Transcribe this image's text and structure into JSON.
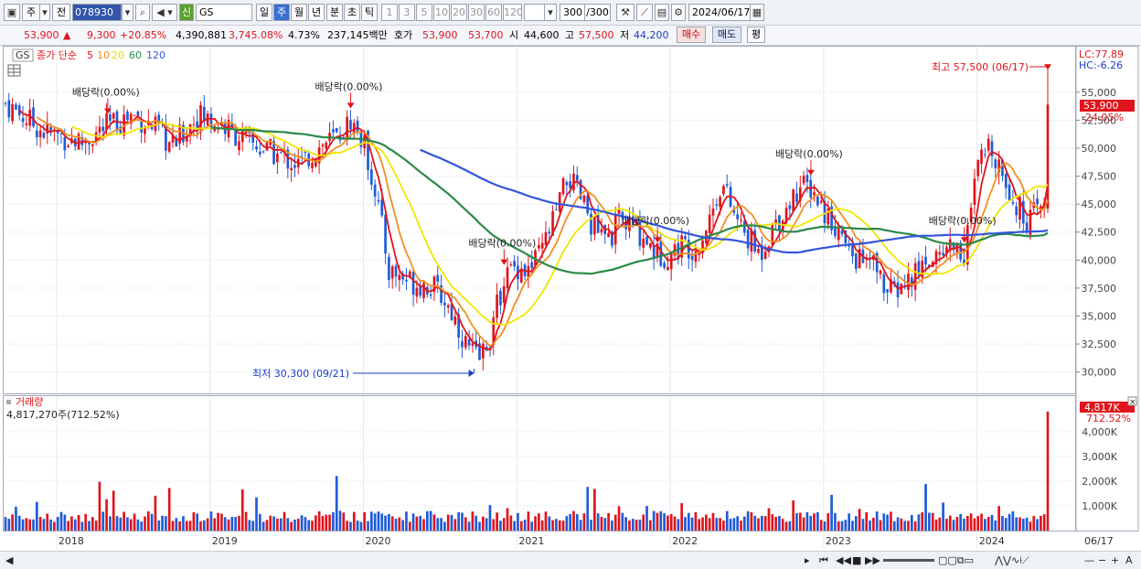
{
  "toolbar": {
    "buttons_left": [
      "주",
      "전"
    ],
    "code": "078930",
    "market_badge": "신",
    "name": "GS",
    "periods": [
      "일",
      "주",
      "월",
      "년",
      "분",
      "초",
      "틱"
    ],
    "selected_period": "주",
    "intervals": [
      "1",
      "3",
      "5",
      "10",
      "20",
      "30",
      "60",
      "120"
    ],
    "count": "300",
    "count_total": "/300",
    "date": "2024/06/17"
  },
  "infobar": {
    "price": "53,900",
    "change_arrow": "▲",
    "change": "9,300",
    "change_pct": "+20.85%",
    "volume": "4,390,881",
    "volume_ratio": "3,745.08%",
    "turnover": "4.73%",
    "amount": "237,145백만",
    "quote_label": "호가",
    "ask": "53,900",
    "bid": "53,700",
    "open_label": "시",
    "open": "44,600",
    "high_label": "고",
    "high": "57,500",
    "low_label": "저",
    "low": "44,200",
    "buy_label": "매수",
    "sell_label": "매도",
    "eval_label": "평"
  },
  "legend": {
    "ticker": "GS",
    "ma_label": "종가 단순",
    "periods": [
      "5",
      "10",
      "20",
      "60",
      "120"
    ],
    "colors": [
      "#e0141c",
      "#f09020",
      "#f0e600",
      "#2a8a4a",
      "#3355dd"
    ]
  },
  "price_panel": {
    "lc": "LC:77.89",
    "hc": "HC:-6.26",
    "current_label": "53,900",
    "current_pct": "24.05%",
    "high_annotation": "최고 57,500 (06/17)",
    "low_annotation": "최저 30,300 (09/21)",
    "dividend_label": "배당락(0.00%)"
  },
  "volume_panel": {
    "title": "거래량",
    "value": "4,817,270주(712.52%)",
    "current_label": "4,817K",
    "current_pct": "712.52%"
  },
  "chart_data": {
    "type": "candlestick",
    "interval": "weekly",
    "y_range": [
      28500,
      58500
    ],
    "y_ticks": [
      30000,
      32500,
      35000,
      37500,
      40000,
      42500,
      45000,
      47500,
      50000,
      52500,
      55000
    ],
    "y_tick_labels": [
      "30,000",
      "32,500",
      "35,000",
      "37,500",
      "40,000",
      "42,500",
      "45,000",
      "47,500",
      "50,000",
      "52,500",
      "55,000"
    ],
    "volume_range": [
      0,
      5000000
    ],
    "volume_ticks": [
      1000000,
      2000000,
      3000000,
      4000000
    ],
    "volume_tick_labels": [
      "1,000K",
      "2,000K",
      "3,000K",
      "4,000K"
    ],
    "x_labels": [
      {
        "label": "2018",
        "date": "2018-01"
      },
      {
        "label": "2019",
        "date": "2019-01"
      },
      {
        "label": "2020",
        "date": "2020-01"
      },
      {
        "label": "2021",
        "date": "2021-01"
      },
      {
        "label": "2022",
        "date": "2022-01"
      },
      {
        "label": "2023",
        "date": "2023-01"
      },
      {
        "label": "2024",
        "date": "2024-01"
      }
    ],
    "x_end_label": "06/17",
    "close_anchors": [
      [
        "2017-09",
        54000
      ],
      [
        "2017-12",
        51500
      ],
      [
        "2018-03",
        50500
      ],
      [
        "2018-05",
        52000
      ],
      [
        "2018-07",
        53000
      ],
      [
        "2018-09",
        51500
      ],
      [
        "2018-10",
        50000
      ],
      [
        "2018-12",
        53000
      ],
      [
        "2019-02",
        52000
      ],
      [
        "2019-04",
        50500
      ],
      [
        "2019-06",
        49500
      ],
      [
        "2019-08",
        48500
      ],
      [
        "2019-10",
        50500
      ],
      [
        "2019-11",
        51000
      ],
      [
        "2019-12",
        52500
      ],
      [
        "2020-01",
        50500
      ],
      [
        "2020-02",
        46000
      ],
      [
        "2020-03",
        39000
      ],
      [
        "2020-04",
        38500
      ],
      [
        "2020-05",
        38000
      ],
      [
        "2020-06",
        37800
      ],
      [
        "2020-07",
        37000
      ],
      [
        "2020-08",
        35200
      ],
      [
        "2020-09",
        32500
      ],
      [
        "2020-10",
        31000
      ],
      [
        "2020-11",
        33500
      ],
      [
        "2020-12",
        38500
      ],
      [
        "2021-01",
        39500
      ],
      [
        "2021-02",
        39000
      ],
      [
        "2021-03",
        41000
      ],
      [
        "2021-04",
        44000
      ],
      [
        "2021-05",
        47500
      ],
      [
        "2021-06",
        45500
      ],
      [
        "2021-07",
        43000
      ],
      [
        "2021-08",
        41500
      ],
      [
        "2021-09",
        43500
      ],
      [
        "2021-10",
        43000
      ],
      [
        "2021-11",
        42000
      ],
      [
        "2021-12",
        40500
      ],
      [
        "2022-01",
        40500
      ],
      [
        "2022-02",
        41500
      ],
      [
        "2022-03",
        41000
      ],
      [
        "2022-04",
        43500
      ],
      [
        "2022-05",
        47000
      ],
      [
        "2022-06",
        44000
      ],
      [
        "2022-07",
        42000
      ],
      [
        "2022-08",
        40500
      ],
      [
        "2022-09",
        43000
      ],
      [
        "2022-10",
        44500
      ],
      [
        "2022-11",
        46500
      ],
      [
        "2022-12",
        46500
      ],
      [
        "2023-01",
        44500
      ],
      [
        "2023-02",
        43000
      ],
      [
        "2023-03",
        40500
      ],
      [
        "2023-04",
        40000
      ],
      [
        "2023-05",
        39500
      ],
      [
        "2023-06",
        37000
      ],
      [
        "2023-07",
        37500
      ],
      [
        "2023-08",
        38500
      ],
      [
        "2023-09",
        40000
      ],
      [
        "2023-10",
        40500
      ],
      [
        "2023-11",
        41500
      ],
      [
        "2023-12",
        40500
      ],
      [
        "2024-01",
        48000
      ],
      [
        "2024-02",
        50500
      ],
      [
        "2024-03",
        48000
      ],
      [
        "2024-04",
        45000
      ],
      [
        "2024-05",
        43500
      ],
      [
        "2024-06",
        44600
      ]
    ],
    "last_bar": {
      "open": 44600,
      "high": 57500,
      "low": 44200,
      "close": 53900,
      "volume": 4817270
    },
    "high_point": {
      "date": "2024-06-17",
      "value": 57500
    },
    "low_point": {
      "date": "2020-09-21",
      "value": 30300
    },
    "dividend_marks": [
      {
        "date": "2018-05",
        "value": 52000
      },
      {
        "date": "2019-12",
        "value": 52500
      },
      {
        "date": "2020-12",
        "value": 38500
      },
      {
        "date": "2021-12",
        "value": 40500
      },
      {
        "date": "2022-12",
        "value": 46500
      },
      {
        "date": "2023-12",
        "value": 40500
      }
    ]
  },
  "bottombar": {
    "controls": [
      "▸",
      "⏮",
      "◀◀",
      "■",
      "▶▶"
    ]
  }
}
